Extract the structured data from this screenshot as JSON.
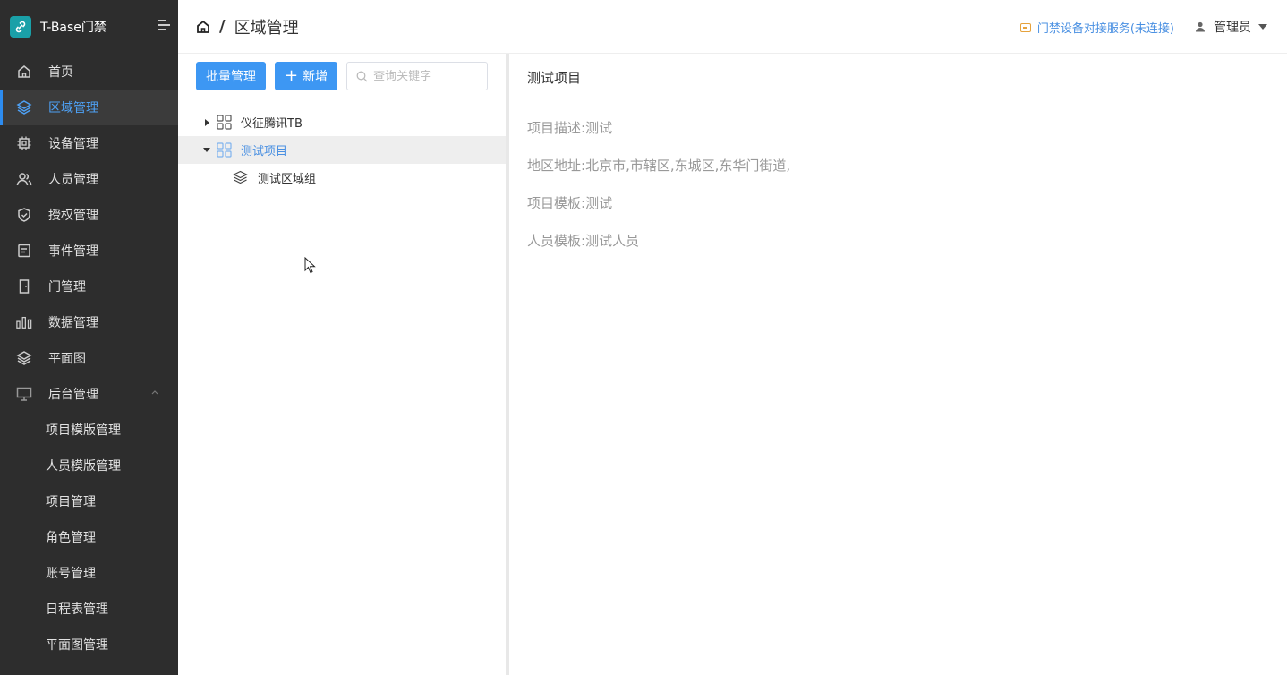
{
  "app": {
    "title": "T-Base门禁"
  },
  "sidebar": {
    "items": [
      {
        "label": "首页",
        "icon": "home-icon"
      },
      {
        "label": "区域管理",
        "icon": "layers-icon",
        "active": true
      },
      {
        "label": "设备管理",
        "icon": "chip-icon"
      },
      {
        "label": "人员管理",
        "icon": "users-icon"
      },
      {
        "label": "授权管理",
        "icon": "shield-icon"
      },
      {
        "label": "事件管理",
        "icon": "document-icon"
      },
      {
        "label": "门管理",
        "icon": "door-icon"
      },
      {
        "label": "数据管理",
        "icon": "bar-chart-icon"
      },
      {
        "label": "平面图",
        "icon": "layers-icon"
      },
      {
        "label": "后台管理",
        "icon": "monitor-icon",
        "expanded": true
      }
    ],
    "submenu": [
      {
        "label": "项目模版管理"
      },
      {
        "label": "人员模版管理"
      },
      {
        "label": "项目管理"
      },
      {
        "label": "角色管理"
      },
      {
        "label": "账号管理"
      },
      {
        "label": "日程表管理"
      },
      {
        "label": "平面图管理"
      }
    ]
  },
  "header": {
    "breadcrumb_sep": "/",
    "title": "区域管理",
    "service_status": "门禁设备对接服务(未连接)",
    "user": "管理员"
  },
  "toolbar": {
    "batch_label": "批量管理",
    "add_label": "新增",
    "search_placeholder": "查询关键字"
  },
  "tree": {
    "nodes": [
      {
        "label": "仪征腾讯TB",
        "expanded": false
      },
      {
        "label": "测试项目",
        "expanded": true,
        "selected": true
      },
      {
        "label": "测试区域组",
        "child": true
      }
    ]
  },
  "detail": {
    "title": "测试项目",
    "rows": [
      {
        "label": "项目描述:",
        "value": "测试"
      },
      {
        "label": "地区地址:",
        "value": "北京市,市辖区,东城区,东华门街道,"
      },
      {
        "label": "项目模板:",
        "value": "测试"
      },
      {
        "label": "人员模板:",
        "value": "测试人员"
      }
    ]
  },
  "colors": {
    "sidebar_bg": "#2d2d2d",
    "accent": "#3d97f3",
    "active_text": "#4ea1f5",
    "logo": "#1aa0a8",
    "warning": "#e6a23c"
  }
}
